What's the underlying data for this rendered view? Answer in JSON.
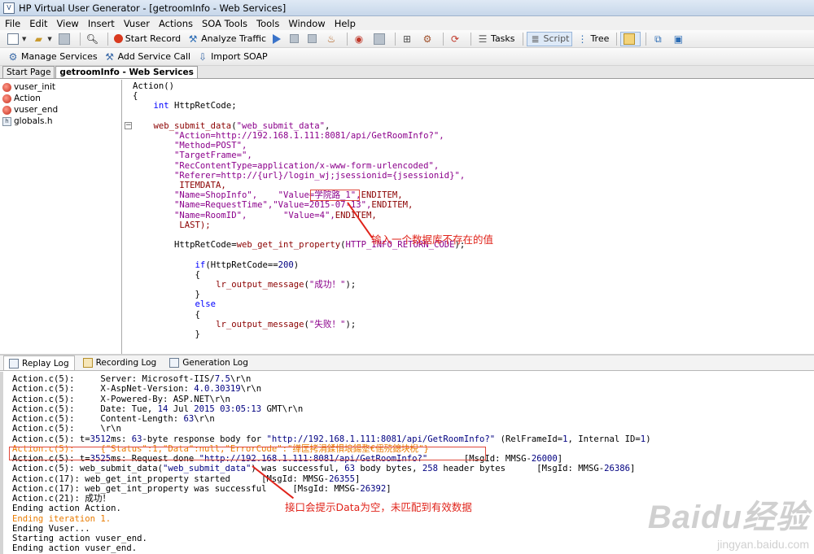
{
  "window": {
    "title": "HP Virtual User Generator - [getroomInfo - Web Services]"
  },
  "menu": [
    "File",
    "Edit",
    "View",
    "Insert",
    "Vuser",
    "Actions",
    "SOA Tools",
    "Tools",
    "Window",
    "Help"
  ],
  "toolbar": {
    "start_record": "Start Record",
    "analyze_traffic": "Analyze Traffic",
    "tasks": "Tasks",
    "script": "Script",
    "tree": "Tree"
  },
  "toolbar2": {
    "manage_services": "Manage Services",
    "add_service_call": "Add Service Call",
    "import_soap": "Import SOAP"
  },
  "doc_tabs": [
    "Start Page",
    "getroomInfo - Web Services"
  ],
  "tree_items": [
    "vuser_init",
    "Action",
    "vuser_end",
    "globals.h"
  ],
  "code": {
    "l1": "Action()",
    "l2": "{",
    "l3_type": "int",
    "l3_rest": " HttpRetCode;",
    "l5_fn": "web_submit_data",
    "l5_arg": "\"web_submit_data\"",
    "l6": "\"Action=http://192.168.1.111:8081/api/GetRoomInfo?\",",
    "l7": "\"Method=POST\",",
    "l8": "\"TargetFrame=\",",
    "l9": "\"RecContentType=application/x-www-form-urlencoded\",",
    "l10": "\"Referer=http://{url}/login_wj;jsessionid={jsessionid}\",",
    "l11": "ITEMDATA,",
    "l12_a": "\"Name=ShopInfo\",",
    "l12_b": "\"Value=学院路_1\",",
    "l12_c": "ENDITEM,",
    "l13_a": "\"Name=RequestTime\",",
    "l13_b": "\"Value=2015-07-13\",",
    "l13_c": "ENDITEM,",
    "l14_a": "\"Name=RoomID\",",
    "l14_b": "\"Value=4\",",
    "l14_c": "ENDITEM,",
    "l15": "LAST);",
    "l17_a": "HttpRetCode=",
    "l17_fn": "web_get_int_property",
    "l17_arg": "HTTP_INFO_RETURN_CODE",
    "l19_kw": "if",
    "l19_a": "(HttpRetCode==",
    "l19_num": "200",
    "l19_b": ")",
    "l20": "{",
    "l21_fn": "lr_output_message",
    "l21_arg": "\"成功！\"",
    "l22": "}",
    "l23": "else",
    "l24": "{",
    "l25_fn": "lr_output_message",
    "l25_arg": "\"失败！\"",
    "l26": "}"
  },
  "annotation1": "输入一个数据库不存在的值",
  "annotation2": "接口会提示Data为空，未匹配到有效数据",
  "output_tabs": [
    "Replay Log",
    "Recording Log",
    "Generation Log"
  ],
  "log": {
    "r1_a": "Action.c(5):     Server: Microsoft-IIS/",
    "r1_b": "7.5",
    "r1_c": "\\r\\n",
    "r2_a": "Action.c(5):     X-AspNet-Version: ",
    "r2_b": "4.0.30319",
    "r2_c": "\\r\\n",
    "r3_a": "Action.c(5):     X-Powered-By: ASP.NET\\r\\n",
    "r4_a": "Action.c(5):     Date: Tue, ",
    "r4_b": "14",
    "r4_c": " Jul ",
    "r4_d": "2015 03:05:13",
    "r4_e": " GMT\\r\\n",
    "r5_a": "Action.c(5):     Content-Length: ",
    "r5_b": "63",
    "r5_c": "\\r\\n",
    "r6_a": "Action.c(5):     \\r\\n",
    "r7_a": "Action.c(5): t=",
    "r7_b": "3512",
    "r7_c": "ms: ",
    "r7_d": "63",
    "r7_e": "-byte response body for ",
    "r7_f": "\"http://192.168.1.111:8081/api/GetRoomInfo?\"",
    "r7_g": " (RelFrameId=",
    "r7_h": "1",
    "r7_i": ", Internal ID=",
    "r7_j": "1",
    "r7_k": ")",
    "r8_a": "Action.c(5):     ",
    "r8_b": "{\"Status\":1,\"Data\":null,\"ErrorCode\":\"缂匡拷涓鍒惧埌鍚堥€傜殑鎴块棿\"}",
    "r9_a": "Action.c(5): t=",
    "r9_b": "3525",
    "r9_c": "ms: Request done ",
    "r9_d": "\"http://192.168.1.111:8081/api/GetRoomInfo?\"",
    "r9_e": "       [MsgId: MMSG-",
    "r9_f": "26000",
    "r9_g": "]",
    "r10_a": "Action.c(5): web_submit_data(",
    "r10_b": "\"web_submit_data\"",
    "r10_c": ") was successful, ",
    "r10_d": "63",
    "r10_e": " body bytes, ",
    "r10_f": "258",
    "r10_g": " header bytes      [MsgId: MMSG-",
    "r10_h": "26386",
    "r10_i": "]",
    "r11_a": "Action.c(17): web_get_int_property started      [MsgId: MMSG-",
    "r11_b": "26355",
    "r11_c": "]",
    "r12_a": "Action.c(17): web_get_int_property was successful     [MsgId: MMSG-",
    "r12_b": "26392",
    "r12_c": "]",
    "r13_a": "Action.c(21): 成功！",
    "r14_a": "Ending action Action.",
    "r15_a": "Ending iteration 1.",
    "r16_a": "Ending Vuser...",
    "r17_a": "Starting action vuser_end.",
    "r18_a": "Ending action vuser_end."
  },
  "watermark": {
    "big": "Baidu经验",
    "small": "jingyan.baidu.com"
  }
}
